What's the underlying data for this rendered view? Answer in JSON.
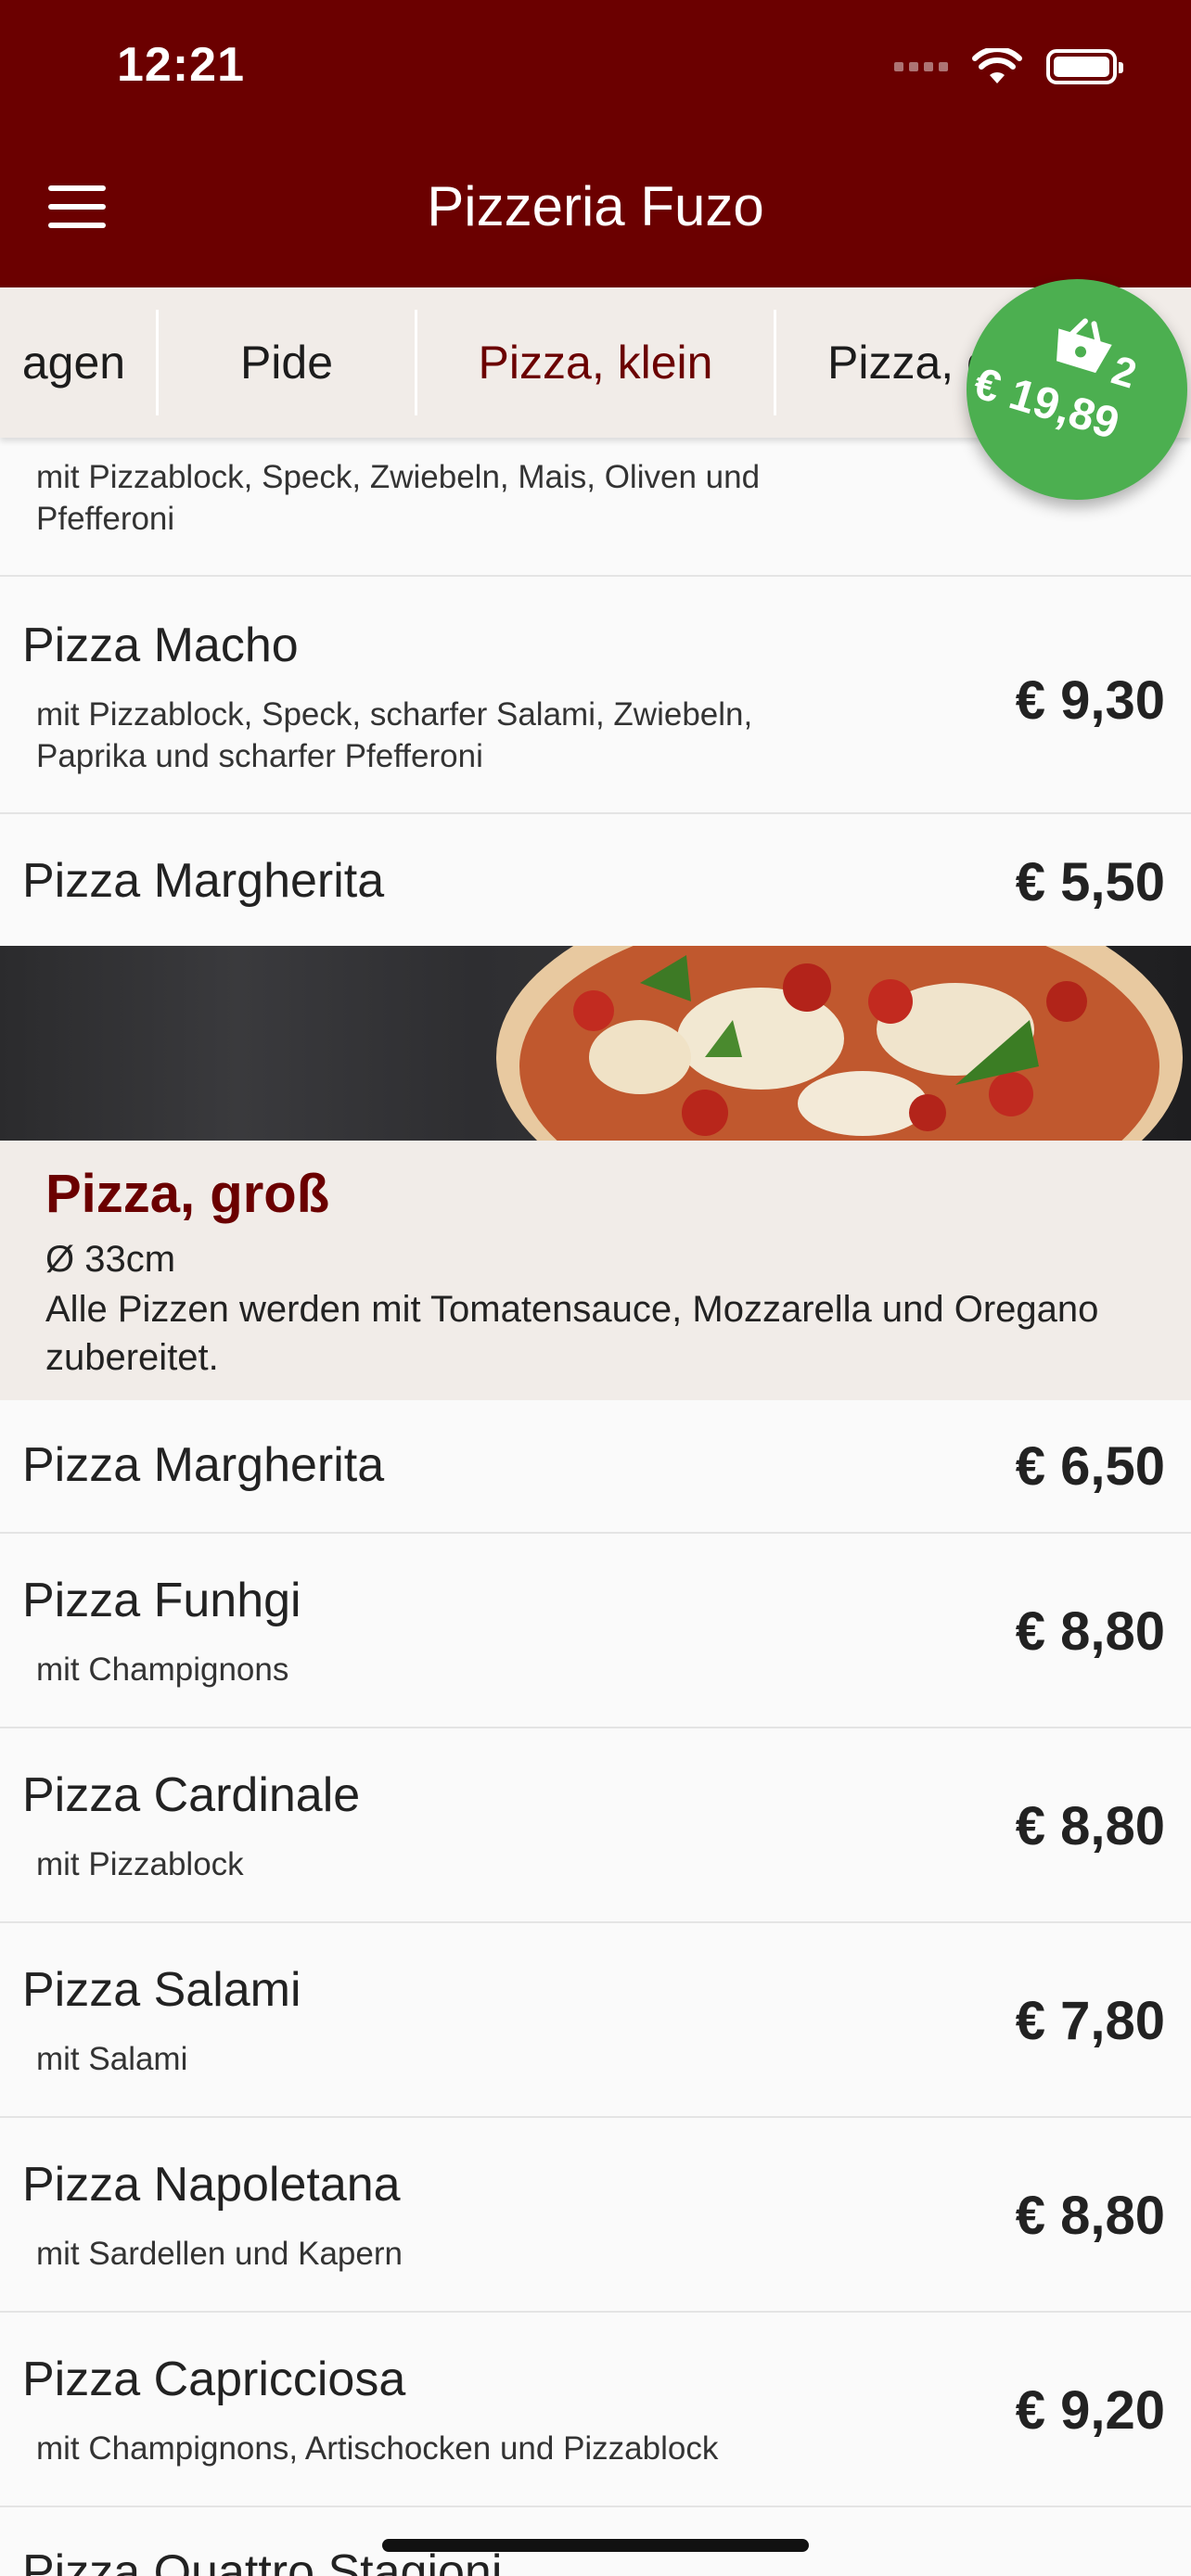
{
  "status_bar": {
    "time": "12:21"
  },
  "header": {
    "title": "Pizzeria Fuzo"
  },
  "tabs": [
    {
      "label": "agen"
    },
    {
      "label": "Pide"
    },
    {
      "label": "Pizza, klein",
      "active": true
    },
    {
      "label": "Pizza, groß"
    }
  ],
  "cart": {
    "count": "2",
    "total": "€ 19,89",
    "color": "#4caf50"
  },
  "items_top": [
    {
      "name": "",
      "description": "mit Pizzablock, Speck, Zwiebeln, Mais, Oliven und Pfefferoni",
      "price": ""
    },
    {
      "name": "Pizza Macho",
      "description": "mit Pizzablock, Speck, scharfer Salami, Zwiebeln, Paprika und scharfer Pfefferoni",
      "price": "€ 9,30"
    },
    {
      "name": "Pizza Margherita",
      "description": "",
      "price": "€ 5,50"
    }
  ],
  "section": {
    "title": "Pizza, groß",
    "size": "Ø 33cm",
    "description": "Alle Pizzen werden mit Tomatensauce, Mozzarella und Oregano zubereitet."
  },
  "items_large": [
    {
      "name": "Pizza Margherita",
      "description": "",
      "price": "€ 6,50"
    },
    {
      "name": "Pizza Funhgi",
      "description": "mit Champignons",
      "price": "€ 8,80"
    },
    {
      "name": "Pizza Cardinale",
      "description": "mit Pizzablock",
      "price": "€ 8,80"
    },
    {
      "name": "Pizza Salami",
      "description": "mit Salami",
      "price": "€ 7,80"
    },
    {
      "name": "Pizza Napoletana",
      "description": "mit Sardellen und Kapern",
      "price": "€ 8,80"
    },
    {
      "name": "Pizza Capricciosa",
      "description": "mit Champignons, Artischocken und Pizzablock",
      "price": "€ 9,20"
    },
    {
      "name": "Pizza Quattro Stagioni",
      "description": "",
      "price": ""
    }
  ],
  "colors": {
    "brand": "#6b0000",
    "section_bg": "#f1ece8",
    "list_bg": "#fafafa"
  }
}
